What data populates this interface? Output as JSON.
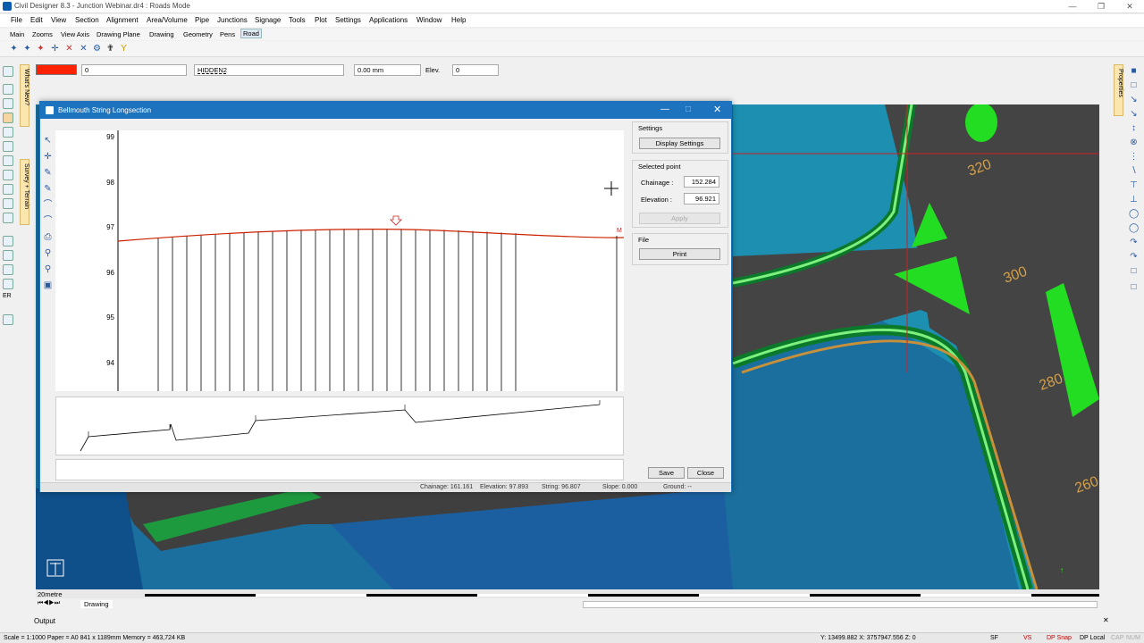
{
  "app": {
    "title": "Civil Designer 8.3 - Junction Webinar.dr4 : Roads Mode",
    "menu": [
      "File",
      "Edit",
      "View",
      "Section",
      "Alignment",
      "Area/Volume",
      "Pipe",
      "Junctions",
      "Signage",
      "Tools",
      "Plot",
      "Settings",
      "Applications",
      "Window",
      "Help"
    ],
    "tabs": [
      "Main",
      "Zooms",
      "View Axis",
      "Drawing Plane",
      "Drawing",
      "Geometry",
      "Pens",
      "Road"
    ],
    "selected_tab": "Road"
  },
  "properties_bar": {
    "layer_value": "0",
    "linetype": "HIDDEN2",
    "width": "0.00 mm",
    "elev_label": "Elev.",
    "elev_value": "0",
    "color": "#ff2200"
  },
  "side_tabs": {
    "whats_new": "What's New?",
    "survey_terrain": "Survey + Terrain",
    "properties": "Properties"
  },
  "dialog": {
    "title": "Bellmouth String Longsection",
    "y_ticks": [
      "99",
      "98",
      "97",
      "96",
      "95",
      "94"
    ],
    "settings_label": "Settings",
    "display_settings": "Display Settings",
    "selected_point_label": "Selected point",
    "chainage_label": "Chainage :",
    "chainage_value": "152.284",
    "elevation_label": "Elevation :",
    "elevation_value": "96.921",
    "apply": "Apply",
    "file_label": "File",
    "print": "Print",
    "save": "Save",
    "close": "Close",
    "marker_letter": "M",
    "status": {
      "chainage": "Chainage: 161.161",
      "elevation": "Elevation: 97.893",
      "string": "String: 96.807",
      "slope": "Slope: 0.000",
      "ground": "Ground: --"
    }
  },
  "canvas": {
    "contours": [
      "320",
      "300",
      "280",
      "260"
    ],
    "scale_label": "20metre"
  },
  "bottom": {
    "drawing_tab": "Drawing",
    "output_label": "Output",
    "status_left": "Scale = 1:1000  Paper = A0 841 x 1189mm  Memory = 463,724 KB",
    "status_coords": "Y: 13499.882  X: 3757947.556  Z: 0",
    "status_sf": "SF",
    "status_vs": "VS",
    "status_dp_snap": "DP Snap",
    "status_dp_local": "DP Local",
    "status_cap": "CAP",
    "status_num": "NUM"
  },
  "colors": {
    "accent": "#1e73be",
    "road": "#4a4a4a",
    "island": "#22cc22",
    "water": "#1a6f9e",
    "profile": "#cc2200"
  }
}
